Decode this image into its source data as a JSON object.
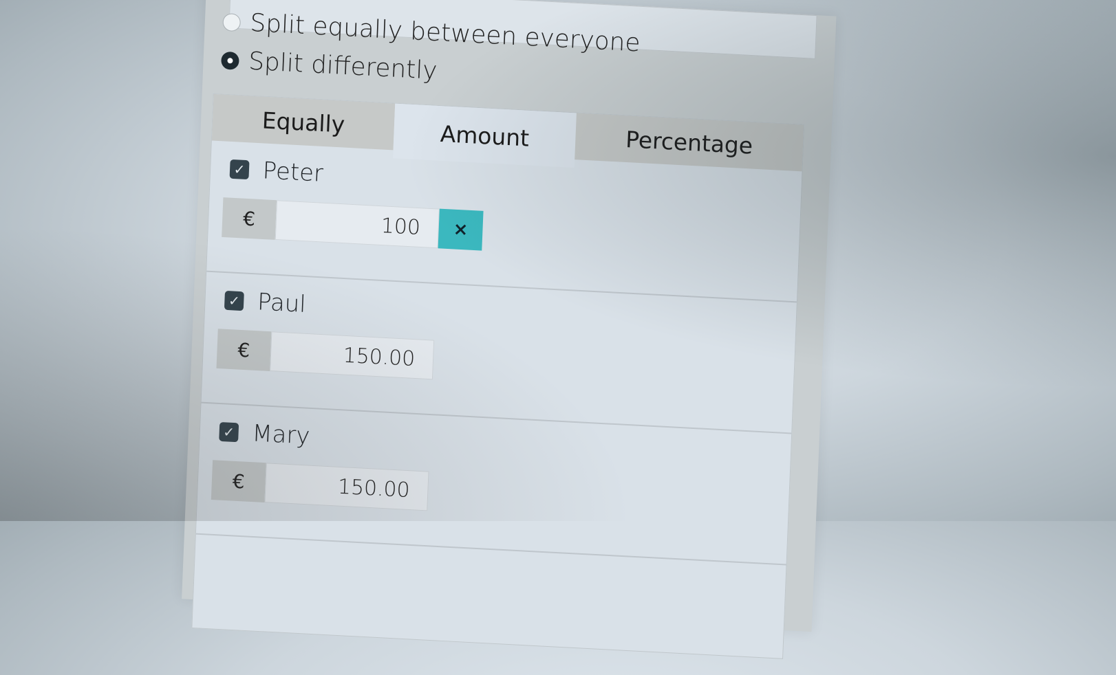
{
  "split_options": {
    "equally_label": "Split equally between everyone",
    "differently_label": "Split differently"
  },
  "tabs": [
    {
      "label": "Equally"
    },
    {
      "label": "Amount"
    },
    {
      "label": "Percentage"
    }
  ],
  "people": [
    {
      "name": "Peter",
      "currency": "€",
      "amount": "100",
      "clear_icon": "×"
    },
    {
      "name": "Paul",
      "currency": "€",
      "amount": "150.00"
    },
    {
      "name": "Mary",
      "currency": "€",
      "amount": "150.00"
    }
  ],
  "checkbox_glyph": "✓",
  "colors": {
    "accent": "#3bb8bf",
    "checkbox": "#34434c",
    "tab_inactive": "#c6c9c8"
  }
}
